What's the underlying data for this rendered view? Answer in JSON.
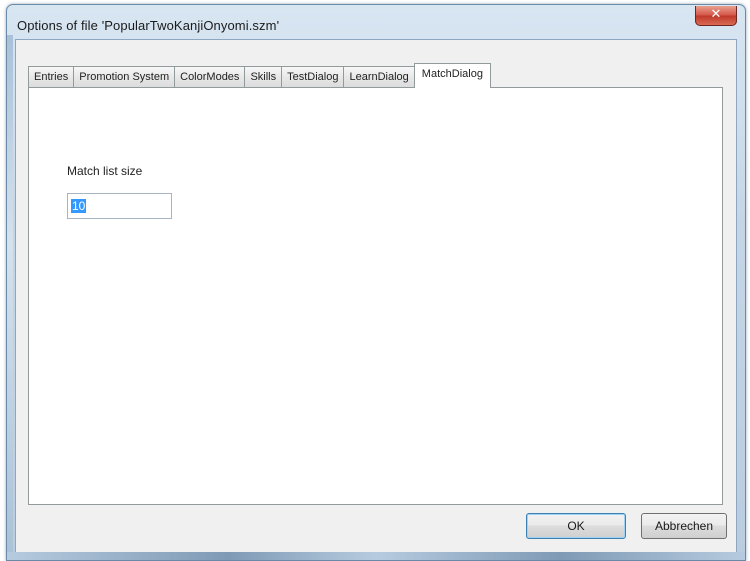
{
  "window": {
    "title": "Options of file 'PopularTwoKanjiOnyomi.szm'",
    "close_icon": "close-icon",
    "close_glyph": "✕",
    "close_color": "#c0392b"
  },
  "tabs": [
    {
      "label": "Entries",
      "active": false
    },
    {
      "label": "Promotion System",
      "active": false
    },
    {
      "label": "ColorModes",
      "active": false
    },
    {
      "label": "Skills",
      "active": false
    },
    {
      "label": "TestDialog",
      "active": false
    },
    {
      "label": "LearnDialog",
      "active": false
    },
    {
      "label": "MatchDialog",
      "active": true
    }
  ],
  "match_dialog": {
    "match_list_size_label": "Match list size",
    "match_list_size_value": "10"
  },
  "buttons": {
    "ok_label": "OK",
    "cancel_label": "Abbrechen"
  }
}
